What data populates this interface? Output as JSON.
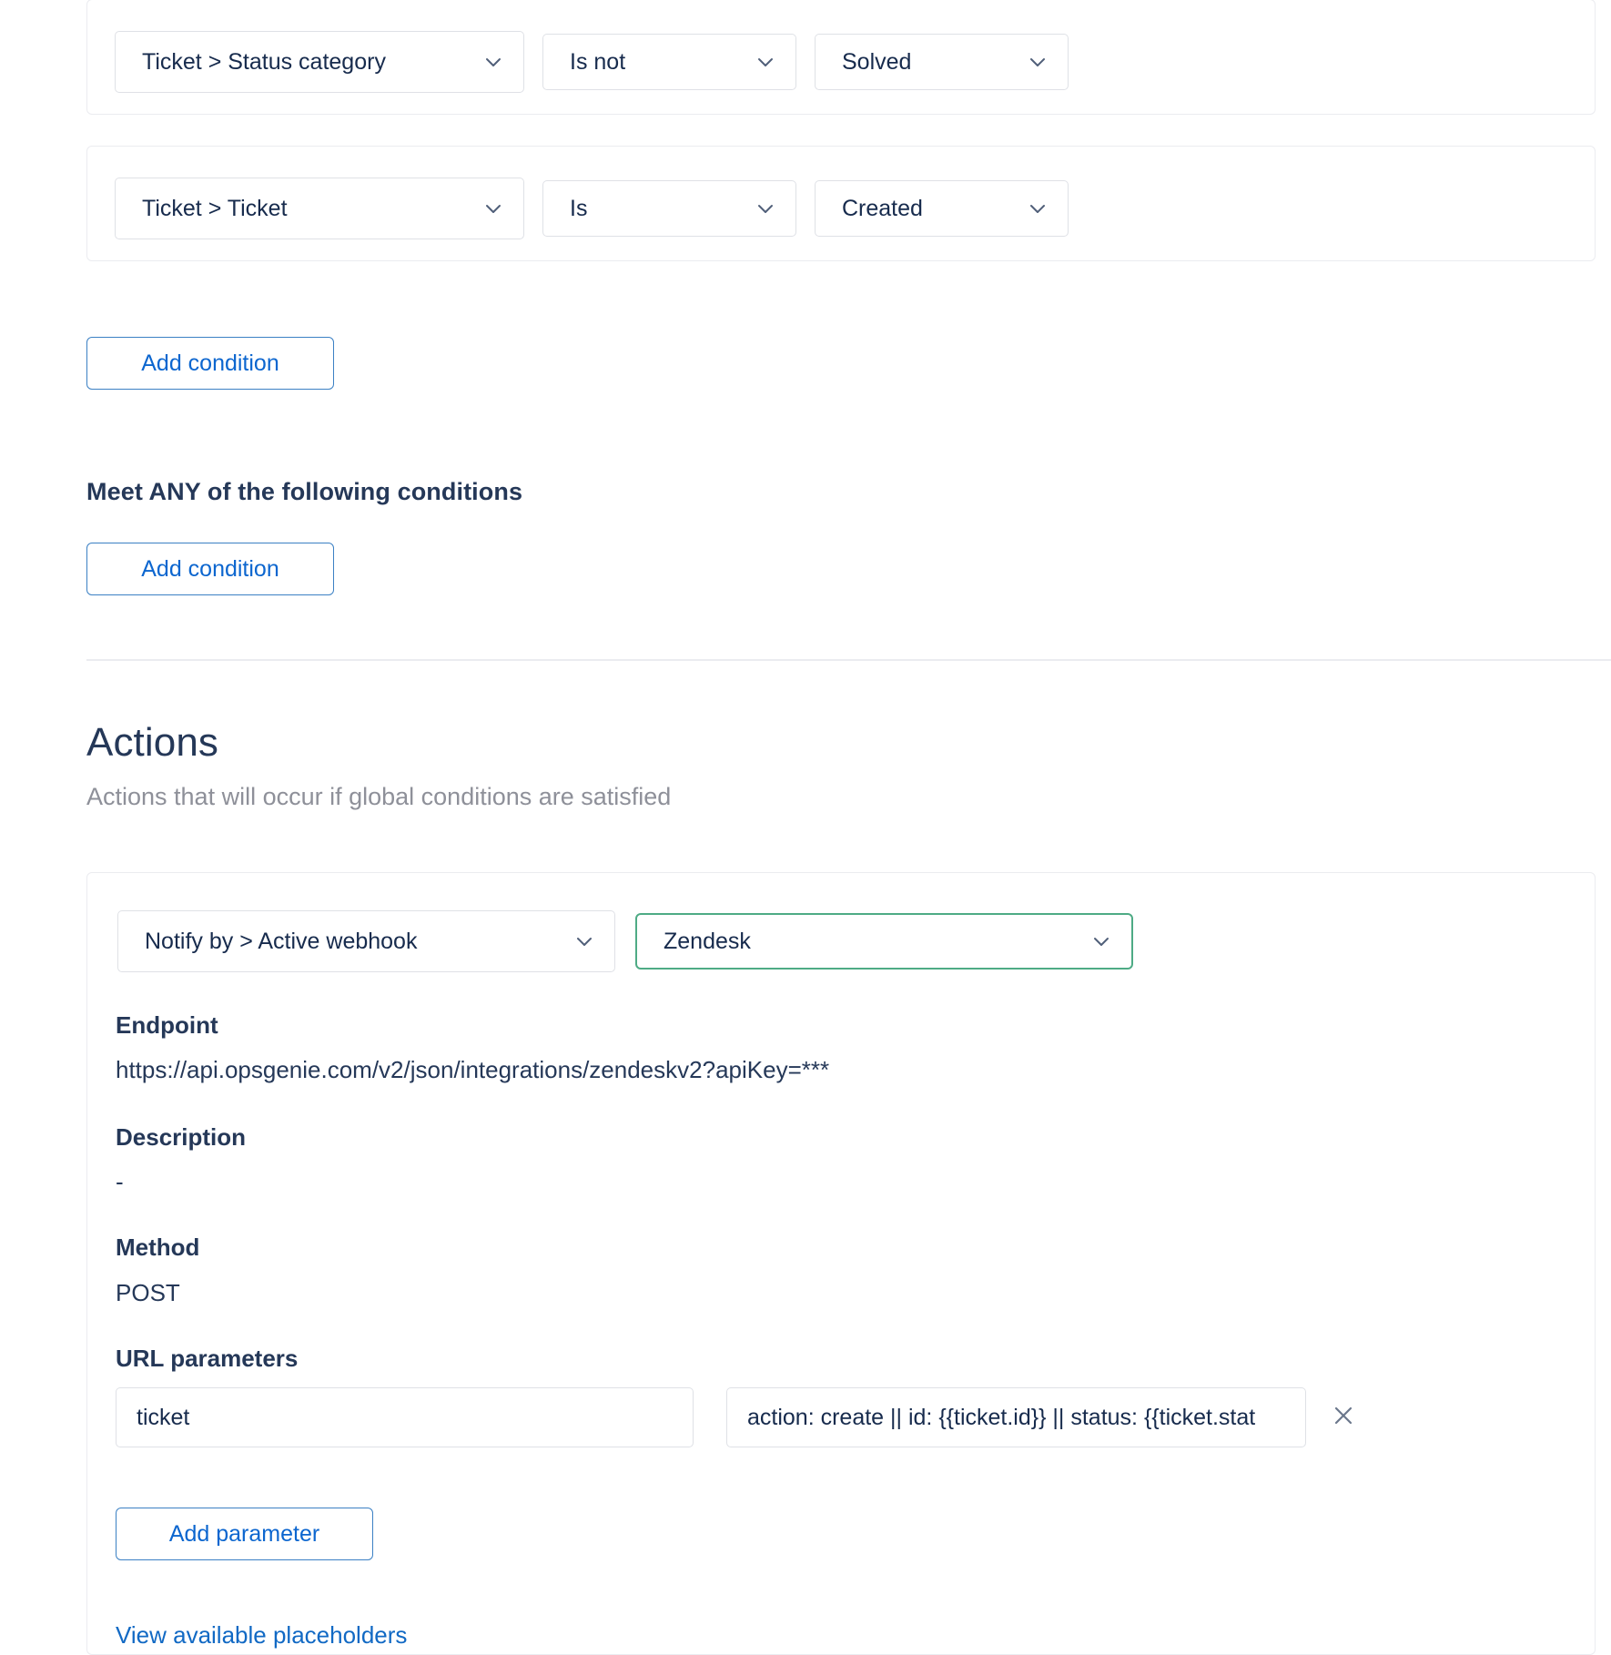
{
  "conditions_all": {
    "rows": [
      {
        "field": "Ticket > Status category",
        "operator": "Is not",
        "value": "Solved"
      },
      {
        "field": "Ticket > Ticket",
        "operator": "Is",
        "value": "Created"
      }
    ],
    "add_condition_label": "Add condition"
  },
  "conditions_any": {
    "heading": "Meet ANY of the following conditions",
    "add_condition_label": "Add condition"
  },
  "actions": {
    "heading": "Actions",
    "subtitle": "Actions that will occur if global conditions are satisfied",
    "action_type": "Notify by > Active webhook",
    "action_target": "Zendesk",
    "details": {
      "endpoint_label": "Endpoint",
      "endpoint_value": "https://api.opsgenie.com/v2/json/integrations/zendeskv2?apiKey=***",
      "description_label": "Description",
      "description_value": "-",
      "method_label": "Method",
      "method_value": "POST",
      "url_parameters_label": "URL parameters"
    },
    "parameter": {
      "key": "ticket",
      "value": "action: create || id: {{ticket.id}} || status: {{ticket.stat",
      "remove_title": "Remove parameter"
    },
    "add_parameter_label": "Add parameter",
    "view_placeholders_label": "View available placeholders"
  },
  "colors": {
    "accent_blue": "#0c66cf",
    "link_blue": "#1169c4",
    "green_border": "#4eab85",
    "text": "#253858",
    "muted": "#8e9099",
    "border": "#dfe1e6",
    "card_border": "#ebecf0"
  },
  "icons": {
    "chevron_down": "chevron-down-icon",
    "close": "close-icon"
  }
}
